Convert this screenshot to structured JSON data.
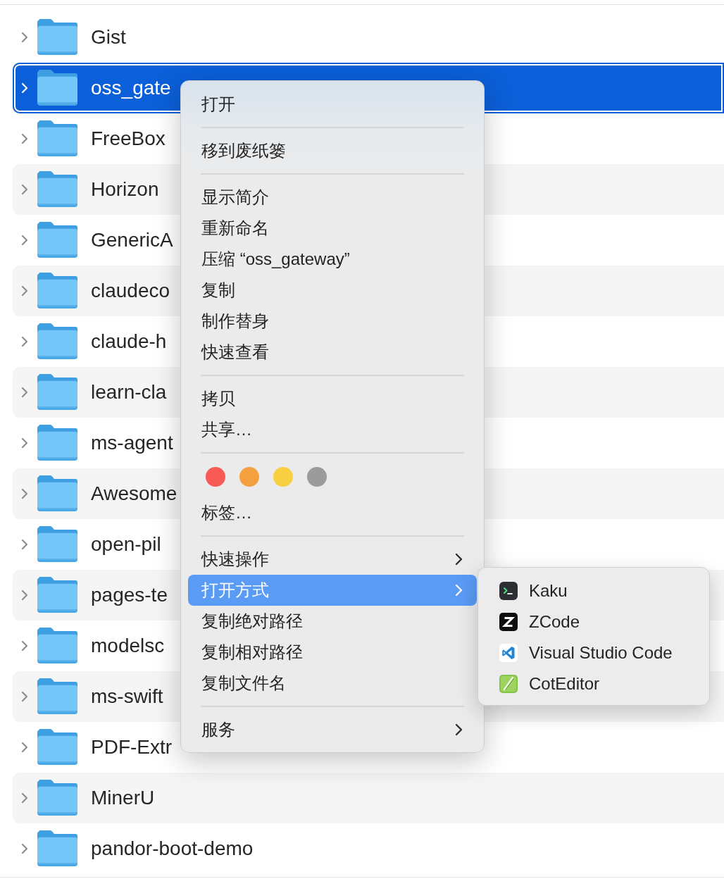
{
  "folders": [
    {
      "name": "Gist",
      "selected": false,
      "expanded": false
    },
    {
      "name": "oss_gate",
      "selected": true,
      "expanded": false
    },
    {
      "name": "FreeBox",
      "selected": false,
      "expanded": false
    },
    {
      "name": "Horizon",
      "selected": false,
      "expanded": false
    },
    {
      "name": "GenericA",
      "selected": false,
      "expanded": false
    },
    {
      "name": "claudeco",
      "selected": false,
      "expanded": false
    },
    {
      "name": "claude-h",
      "selected": false,
      "expanded": false
    },
    {
      "name": "learn-cla",
      "selected": false,
      "expanded": false
    },
    {
      "name": "ms-agent",
      "selected": false,
      "expanded": false
    },
    {
      "name": "Awesome",
      "selected": false,
      "expanded": false
    },
    {
      "name": "open-pil",
      "selected": false,
      "expanded": false
    },
    {
      "name": "pages-te",
      "selected": false,
      "expanded": false
    },
    {
      "name": "modelsc",
      "selected": false,
      "expanded": false
    },
    {
      "name": "ms-swift",
      "selected": false,
      "expanded": false
    },
    {
      "name": "PDF-Extr",
      "selected": false,
      "expanded": false
    },
    {
      "name": "MinerU",
      "selected": false,
      "expanded": false
    },
    {
      "name": "pandor-boot-demo",
      "selected": false,
      "expanded": false
    }
  ],
  "context_menu": {
    "items": [
      {
        "kind": "item",
        "label": "打开",
        "has_submenu": false,
        "selected": false
      },
      {
        "kind": "separator"
      },
      {
        "kind": "item",
        "label": "移到废纸篓",
        "has_submenu": false,
        "selected": false
      },
      {
        "kind": "separator"
      },
      {
        "kind": "item",
        "label": "显示简介",
        "has_submenu": false,
        "selected": false
      },
      {
        "kind": "item",
        "label": "重新命名",
        "has_submenu": false,
        "selected": false
      },
      {
        "kind": "item",
        "label": "压缩 “oss_gateway”",
        "has_submenu": false,
        "selected": false
      },
      {
        "kind": "item",
        "label": "复制",
        "has_submenu": false,
        "selected": false
      },
      {
        "kind": "item",
        "label": "制作替身",
        "has_submenu": false,
        "selected": false
      },
      {
        "kind": "item",
        "label": "快速查看",
        "has_submenu": false,
        "selected": false
      },
      {
        "kind": "separator"
      },
      {
        "kind": "item",
        "label": "拷贝",
        "has_submenu": false,
        "selected": false
      },
      {
        "kind": "item",
        "label": "共享…",
        "has_submenu": false,
        "selected": false
      },
      {
        "kind": "separator"
      },
      {
        "kind": "tags",
        "tags": [
          {
            "color": "#f85a55"
          },
          {
            "color": "#f5a03f"
          },
          {
            "color": "#f9cf42"
          },
          {
            "color": "#9b9b9b"
          }
        ]
      },
      {
        "kind": "item",
        "label": "标签…",
        "has_submenu": false,
        "selected": false
      },
      {
        "kind": "separator"
      },
      {
        "kind": "item",
        "label": "快速操作",
        "has_submenu": true,
        "selected": false
      },
      {
        "kind": "item",
        "label": "打开方式",
        "has_submenu": true,
        "selected": true
      },
      {
        "kind": "item",
        "label": "复制绝对路径",
        "has_submenu": false,
        "selected": false
      },
      {
        "kind": "item",
        "label": "复制相对路径",
        "has_submenu": false,
        "selected": false
      },
      {
        "kind": "item",
        "label": "复制文件名",
        "has_submenu": false,
        "selected": false
      },
      {
        "kind": "separator"
      },
      {
        "kind": "item",
        "label": "服务",
        "has_submenu": true,
        "selected": false
      }
    ]
  },
  "submenu": {
    "items": [
      {
        "label": "Kaku",
        "selected": false
      },
      {
        "label": "ZCode",
        "selected": false
      },
      {
        "label": "Visual Studio Code",
        "selected": false
      },
      {
        "label": "CotEditor",
        "selected": false
      }
    ]
  }
}
